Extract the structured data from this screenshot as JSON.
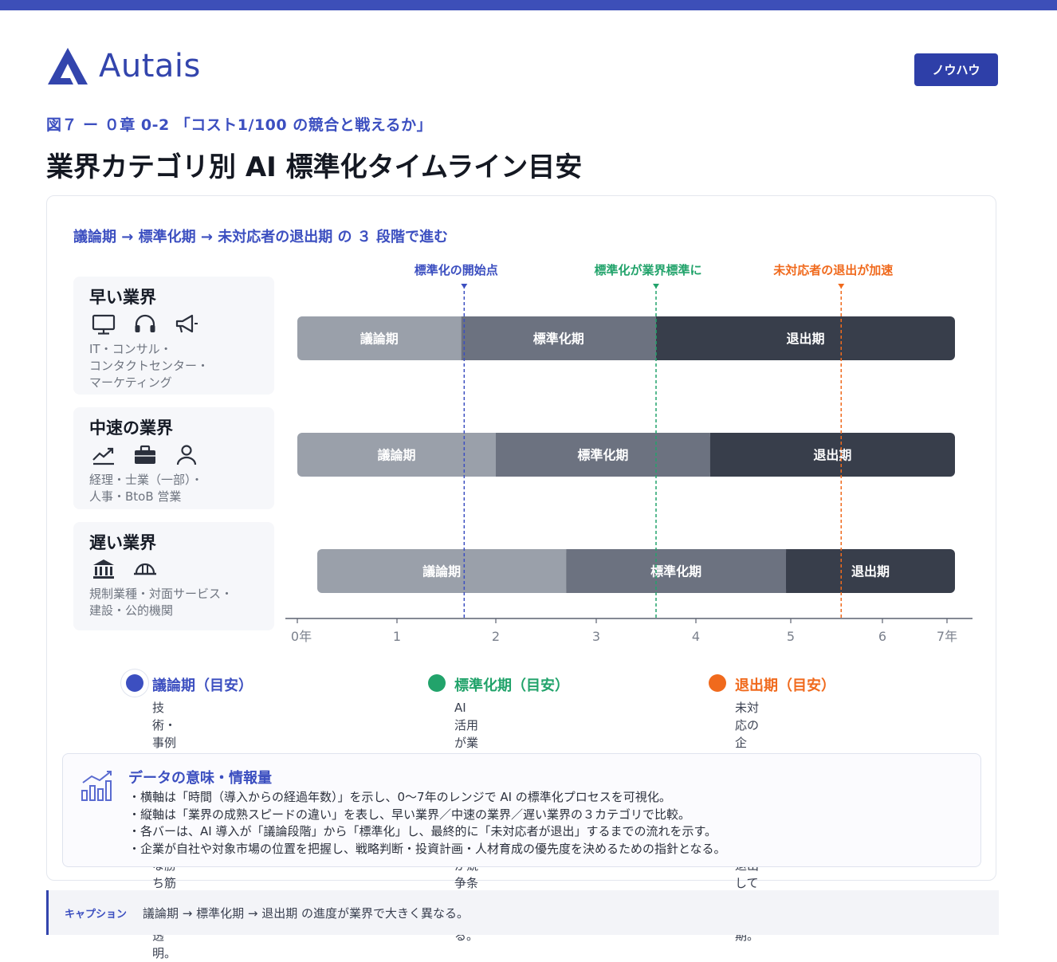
{
  "brand": {
    "name": "Autais",
    "tag_button": "ノウハウ",
    "color": "#3345ad"
  },
  "figure": {
    "number": "図７ ー ０章 0-2 「コスト1/100 の競合と戦えるか」",
    "title": "業界カテゴリ別 AI 標準化タイムライン目安",
    "subtitle": "議論期 → 標準化期 → 未対応者の退出期 の ３ 段階で進む"
  },
  "categories": [
    {
      "name": "早い業界",
      "icons": [
        "monitor-icon",
        "headset-icon",
        "megaphone-icon"
      ],
      "desc": "IT・コンサル・\nコンタクトセンター・\nマーケティング"
    },
    {
      "name": "中速の業界",
      "icons": [
        "trend-up-icon",
        "briefcase-icon",
        "person-icon"
      ],
      "desc": "経理・士業（一部）・\n人事・BtoB 営業"
    },
    {
      "name": "遅い業界",
      "icons": [
        "bank-icon",
        "helmet-icon"
      ],
      "desc": "規制業種・対面サービス・\n建設・公的機関"
    }
  ],
  "chart_data": {
    "type": "bar",
    "orientation": "horizontal-stacked",
    "x_unit": "年",
    "xlim": [
      0,
      7
    ],
    "x_ticks": [
      "0年",
      "1",
      "2",
      "3",
      "4",
      "5",
      "6",
      "7年"
    ],
    "phase_colors": {
      "議論期": "#9aa0aa",
      "標準化期": "#6c7280",
      "退出期": "#383e4b"
    },
    "rows": [
      {
        "category": "早い業界",
        "segments": [
          {
            "phase": "議論期",
            "start": 0,
            "end": 1.65
          },
          {
            "phase": "標準化期",
            "start": 1.65,
            "end": 3.6
          },
          {
            "phase": "退出期",
            "start": 3.6,
            "end": 6.7
          }
        ]
      },
      {
        "category": "中速の業界",
        "segments": [
          {
            "phase": "議論期",
            "start": 0,
            "end": 2.0
          },
          {
            "phase": "標準化期",
            "start": 2.0,
            "end": 4.15
          },
          {
            "phase": "退出期",
            "start": 4.15,
            "end": 6.7
          }
        ]
      },
      {
        "category": "遅い業界",
        "segments": [
          {
            "phase": "議論期",
            "start": 0.2,
            "end": 2.7
          },
          {
            "phase": "標準化期",
            "start": 2.7,
            "end": 4.95
          },
          {
            "phase": "退出期",
            "start": 4.95,
            "end": 6.7
          }
        ]
      }
    ],
    "markers": [
      {
        "label": "標準化の開始点",
        "x": 1.68,
        "color": "#3c4fc0"
      },
      {
        "label": "標準化が業界標準に",
        "x": 3.6,
        "color": "#22a36b"
      },
      {
        "label": "未対応者の退出が加速",
        "x": 5.55,
        "color": "#f06a1d"
      }
    ]
  },
  "legend": [
    {
      "title": "議論期（目安）",
      "color": "#3c4fc0",
      "desc": "技術・事例の検証や議論が中心。\n明確な勝ち筋はまだ不透明。"
    },
    {
      "title": "標準化期（目安）",
      "color": "#22a36b",
      "desc": "AI 活用が業界の標準プロセスに。\n導入が競争条件になる。"
    },
    {
      "title": "退出期（目安）",
      "color": "#f06a1d",
      "desc": "未対応の企業・プレイヤーが\n市場から退出していく時期。"
    }
  ],
  "info": {
    "title": "データの意味・情報量",
    "items": [
      "・横軸は「時間（導入からの経過年数）」を示し、0〜7年のレンジで AI の標準化プロセスを可視化。",
      "・縦軸は「業界の成熟スピードの違い」を表し、早い業界／中速の業界／遅い業界の３カテゴリで比較。",
      "・各バーは、AI 導入が「議論段階」から「標準化」し、最終的に「未対応者が退出」するまでの流れを示す。",
      "・企業が自社や対象市場の位置を把握し、戦略判断・投資計画・人材育成の優先度を決めるための指針となる。"
    ]
  },
  "caption": {
    "label": "キャプション",
    "text": "議論期 → 標準化期 → 退出期 の進度が業界で大きく異なる。"
  }
}
